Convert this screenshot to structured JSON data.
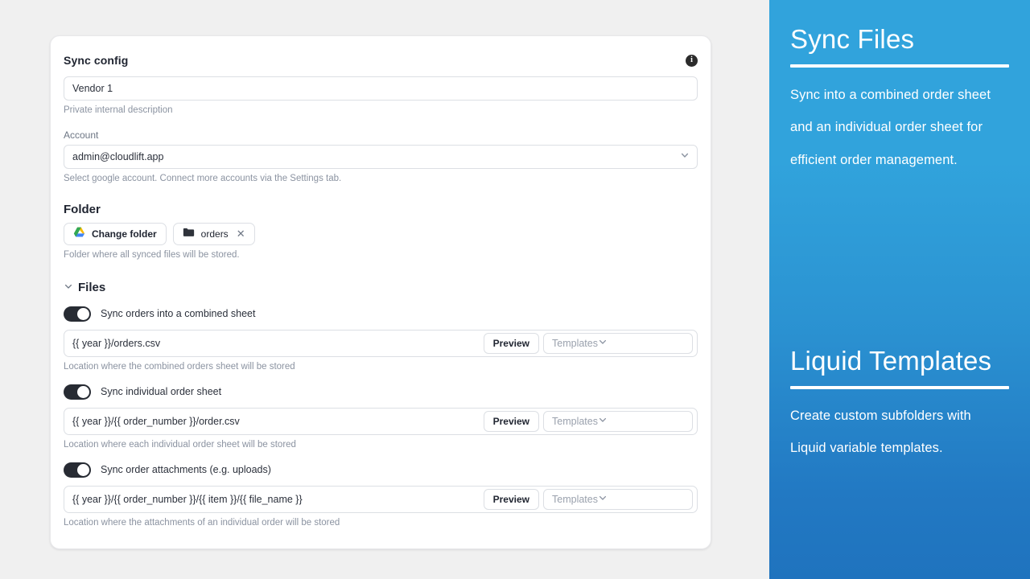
{
  "card": {
    "title": "Sync config",
    "info_icon": "info-icon",
    "name_field": {
      "value": "Vendor 1",
      "placeholder": "Name",
      "helper": "Private internal description"
    },
    "account": {
      "label": "Account",
      "value": "admin@cloudlift.app",
      "helper": "Select google account. Connect more accounts via the Settings tab.",
      "chevron_icon": "chevron-down-icon"
    },
    "folder": {
      "title": "Folder",
      "change_button": "Change folder",
      "drive_icon": "google-drive-icon",
      "folder_icon": "folder-icon",
      "folder_name": "orders",
      "remove_icon": "close-icon",
      "helper": "Folder where all synced files will be stored."
    },
    "files": {
      "title": "Files",
      "collapse_icon": "chevron-down-icon",
      "rows": [
        {
          "toggle_label": "Sync orders into a combined sheet",
          "toggle_on": true,
          "path_value": "{{ year }}/orders.csv",
          "path_placeholder": "Path",
          "preview_label": "Preview",
          "templates_placeholder": "Templates",
          "templates_chevron": "chevron-down-icon",
          "helper": "Location where the combined orders sheet will be stored"
        },
        {
          "toggle_label": "Sync individual order sheet",
          "toggle_on": true,
          "path_value": "{{ year }}/{{ order_number }}/order.csv",
          "path_placeholder": "Path",
          "preview_label": "Preview",
          "templates_placeholder": "Templates",
          "templates_chevron": "chevron-down-icon",
          "helper": "Location where each individual order sheet will be stored"
        },
        {
          "toggle_label": "Sync order attachments (e.g. uploads)",
          "toggle_on": true,
          "path_value": "{{ year }}/{{ order_number }}/{{ item }}/{{ file_name }}",
          "path_placeholder": "Path",
          "preview_label": "Preview",
          "templates_placeholder": "Templates",
          "templates_chevron": "chevron-down-icon",
          "helper": "Location where the attachments of an individual order will be stored"
        }
      ]
    }
  },
  "promo": {
    "blocks": [
      {
        "title": "Sync Files",
        "body": "Sync into a combined order sheet and an individual order sheet for efficient order management."
      },
      {
        "title": "Liquid Templates",
        "body": "Create custom subfolders with Liquid variable templates."
      }
    ]
  },
  "colors": {
    "page_background": "#f0f0f0",
    "card_background": "#ffffff",
    "promo_gradient_top": "#31a3dc",
    "promo_gradient_bottom": "#1f73be",
    "toggle_on": "#272b33",
    "text_primary": "#1f2430",
    "text_muted": "#8b93a1"
  }
}
